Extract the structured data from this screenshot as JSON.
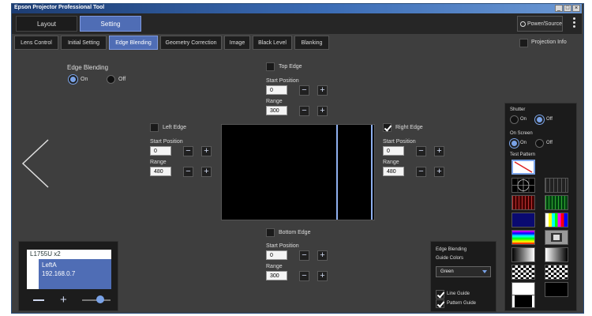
{
  "window": {
    "title": "Epson Projector Professional Tool"
  },
  "top_tabs": [
    "Layout",
    "Setting"
  ],
  "power_label": "Power/Source",
  "sub_tabs": [
    "Lens Control",
    "Initial Setting",
    "Edge Blending",
    "Geometry Correction",
    "Image",
    "Black Level",
    "Blanking"
  ],
  "projection_info": "Projection Info",
  "edge_blending": {
    "label": "Edge Blending",
    "on": "On",
    "off": "Off",
    "selected": "On"
  },
  "top_edge": {
    "label": "Top Edge",
    "start_label": "Start Position",
    "start": "0",
    "range_label": "Range",
    "range": "300",
    "checked": false
  },
  "left_edge": {
    "label": "Left Edge",
    "start_label": "Start Position",
    "start": "0",
    "range_label": "Range",
    "range": "480",
    "checked": false
  },
  "right_edge": {
    "label": "Right Edge",
    "start_label": "Start Position",
    "start": "0",
    "range_label": "Range",
    "range": "480",
    "checked": true
  },
  "bottom_edge": {
    "label": "Bottom Edge",
    "start_label": "Start Position",
    "start": "0",
    "range_label": "Range",
    "range": "300",
    "checked": false
  },
  "side_panel": {
    "shutter": {
      "label": "Shutter",
      "on": "On",
      "off": "Off",
      "selected": "Off"
    },
    "on_screen": {
      "label": "On Screen",
      "on": "On",
      "off": "Off",
      "selected": "On"
    },
    "test_pattern": "Test Pattern"
  },
  "guide_panel": {
    "title": "Edge Blending",
    "subtitle": "Guide Colors",
    "color": "Green",
    "line_guide": "Line Guide",
    "pattern_guide": "Pattern Guide"
  },
  "projector": {
    "model": "L1755U x2",
    "name": "LeftA",
    "ip": "192.168.0.7"
  },
  "colors": {
    "accent": "#4f6db5",
    "background": "#3e3e3e",
    "screen_line": "#8fb0f0"
  }
}
